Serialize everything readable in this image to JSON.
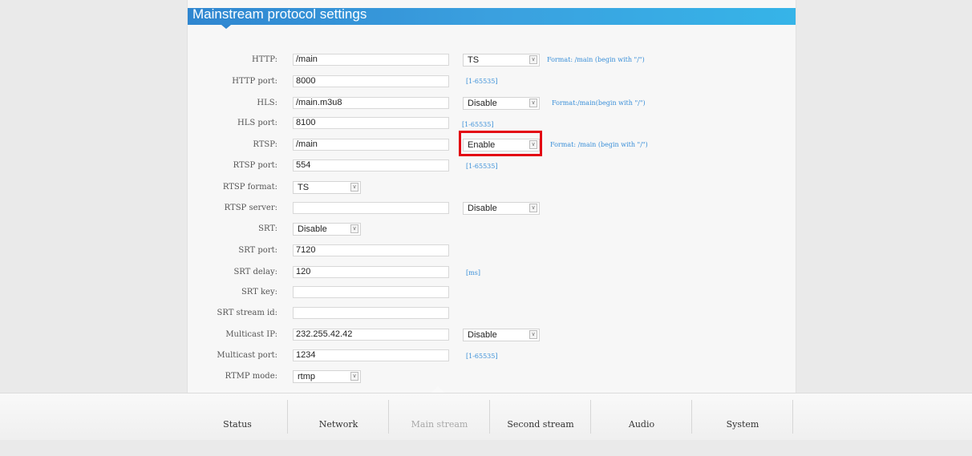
{
  "panel": {
    "title": "Mainstream protocol settings"
  },
  "fields": {
    "http": {
      "label": "HTTP:",
      "value": "/main",
      "select": "TS",
      "hint": "Format: /main (begin with \"/\")"
    },
    "http_port": {
      "label": "HTTP port:",
      "value": "8000",
      "hint": "[1-65535]"
    },
    "hls": {
      "label": "HLS:",
      "value": "/main.m3u8",
      "select": "Disable",
      "hint": "Format:/main(begin with \"/\")"
    },
    "hls_port": {
      "label": "HLS port:",
      "value": "8100",
      "hint": "[1-65535]"
    },
    "rtsp": {
      "label": "RTSP:",
      "value": "/main",
      "select": "Enable",
      "hint": "Format: /main (begin with \"/\")"
    },
    "rtsp_port": {
      "label": "RTSP port:",
      "value": "554",
      "hint": "[1-65535]"
    },
    "rtsp_format": {
      "label": "RTSP format:",
      "select": "TS"
    },
    "rtsp_server": {
      "label": "RTSP server:",
      "value": "",
      "select": "Disable"
    },
    "srt": {
      "label": "SRT:",
      "select": "Disable"
    },
    "srt_port": {
      "label": "SRT port:",
      "value": "7120"
    },
    "srt_delay": {
      "label": "SRT delay:",
      "value": "120",
      "hint": "[ms]"
    },
    "srt_key": {
      "label": "SRT key:",
      "value": ""
    },
    "srt_stream_id": {
      "label": "SRT stream id:",
      "value": ""
    },
    "multicast_ip": {
      "label": "Multicast IP:",
      "value": "232.255.42.42",
      "select": "Disable"
    },
    "multicast_port": {
      "label": "Multicast port:",
      "value": "1234",
      "hint": "[1-65535]"
    },
    "rtmp_mode": {
      "label": "RTMP mode:",
      "select": "rtmp"
    }
  },
  "tabs": [
    "Status",
    "Network",
    "Main stream",
    "Second stream",
    "Audio",
    "System"
  ],
  "active_tab": "Main stream",
  "icons": {
    "dropdown": "chevron-down-icon"
  },
  "colors": {
    "header": "#3aa0df",
    "hint": "#3a8fd8",
    "highlight": "#e30613"
  }
}
